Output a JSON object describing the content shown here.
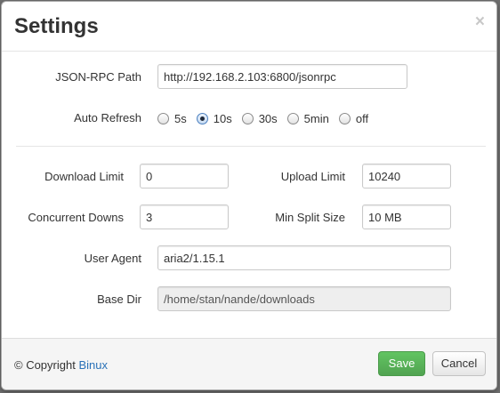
{
  "dialog": {
    "title": "Settings",
    "close_glyph": "×"
  },
  "fields": {
    "rpc_path": {
      "label": "JSON-RPC Path",
      "value": "http://192.168.2.103:6800/jsonrpc"
    },
    "auto_refresh": {
      "label": "Auto Refresh",
      "options": [
        "5s",
        "10s",
        "30s",
        "5min",
        "off"
      ],
      "selected": "10s"
    },
    "download_limit": {
      "label": "Download Limit",
      "value": "0"
    },
    "upload_limit": {
      "label": "Upload Limit",
      "value": "10240"
    },
    "concurrent_downs": {
      "label": "Concurrent Downs",
      "value": "3"
    },
    "min_split_size": {
      "label": "Min Split Size",
      "value": "10 MB"
    },
    "user_agent": {
      "label": "User Agent",
      "value": "aria2/1.15.1"
    },
    "base_dir": {
      "label": "Base Dir",
      "value": "/home/stan/nande/downloads"
    }
  },
  "footer": {
    "copyright_prefix": "© Copyright ",
    "author_link": "Binux",
    "save_label": "Save",
    "cancel_label": "Cancel"
  },
  "colors": {
    "save_button": "#5bb75b",
    "link": "#2a72b8",
    "overlay": "#6f6f6f"
  }
}
